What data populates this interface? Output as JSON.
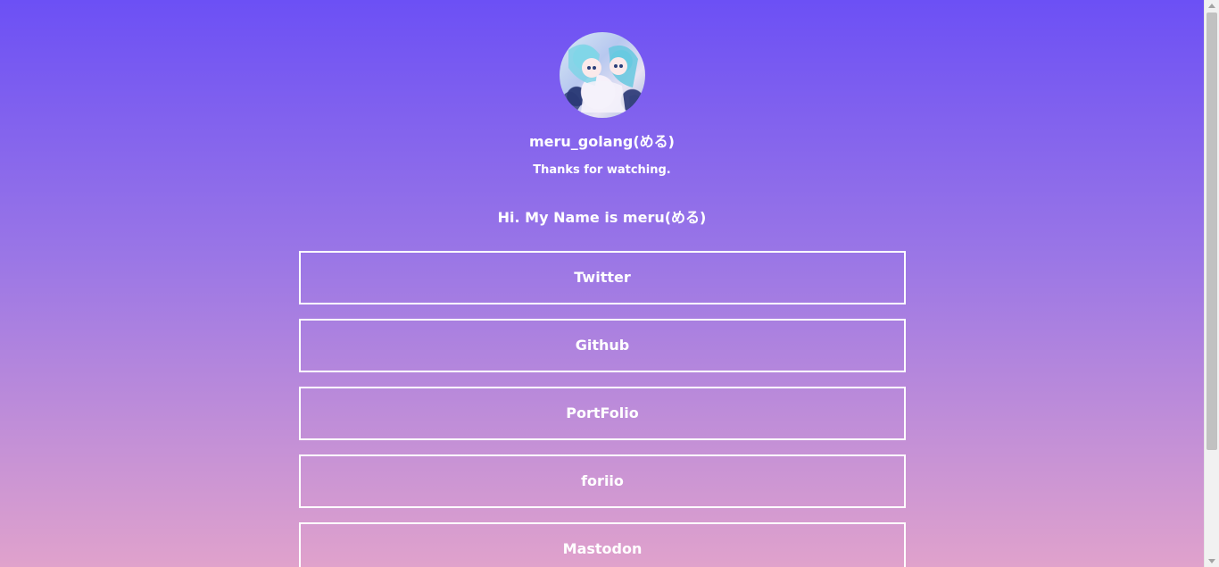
{
  "profile": {
    "username": "meru_golang(める)",
    "tagline": "Thanks for watching.",
    "intro": "Hi. My Name is meru(める)"
  },
  "links": [
    {
      "label": "Twitter"
    },
    {
      "label": "Github"
    },
    {
      "label": "PortFolio"
    },
    {
      "label": "foriio"
    },
    {
      "label": "Mastodon"
    }
  ],
  "colors": {
    "gradient_top": "#6c50f5",
    "gradient_bottom": "#e0a2cc",
    "text": "#ffffff"
  }
}
